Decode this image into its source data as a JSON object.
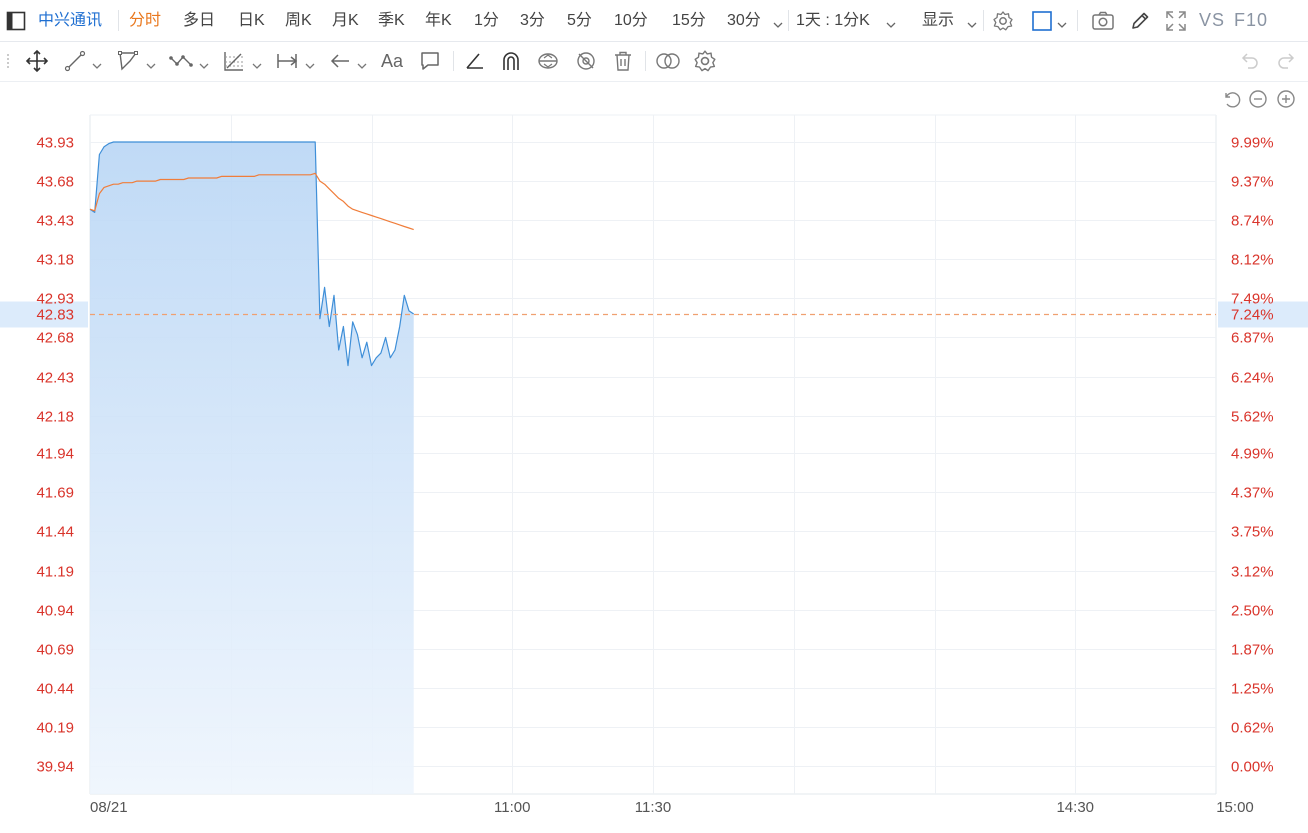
{
  "topbar": {
    "stock_name": "中兴通讯",
    "periods": [
      "分时",
      "多日",
      "日K",
      "周K",
      "月K",
      "季K",
      "年K",
      "1分",
      "3分",
      "5分",
      "10分",
      "15分",
      "30分"
    ],
    "active_period": "分时",
    "candle_mode": "1天 : 1分K",
    "display_label": "显示",
    "vs_label": "VS",
    "f10_label": "F10"
  },
  "drawing_toolbar": {
    "text_tool_label": "Aa"
  },
  "chart_data": {
    "type": "line",
    "title": "",
    "x_ticks": [
      "08/21",
      "11:00",
      "11:30",
      "14:30",
      "15:00"
    ],
    "price_ticks": [
      43.93,
      43.68,
      43.43,
      43.18,
      42.93,
      42.68,
      42.43,
      42.18,
      41.94,
      41.69,
      41.44,
      41.19,
      40.94,
      40.69,
      40.44,
      40.19,
      39.94
    ],
    "pct_ticks": [
      "9.99%",
      "9.37%",
      "8.74%",
      "8.12%",
      "7.49%",
      "6.87%",
      "6.24%",
      "5.62%",
      "4.99%",
      "4.37%",
      "3.75%",
      "3.12%",
      "2.50%",
      "1.87%",
      "1.25%",
      "0.62%",
      "0.00%"
    ],
    "ylim": [
      39.94,
      43.93
    ],
    "current_price": "42.83",
    "current_pct": "7.24%",
    "trading_minutes": 240,
    "series": [
      {
        "color": "#3f8fd8",
        "values": [
          43.5,
          43.48,
          43.85,
          43.9,
          43.92,
          43.93,
          43.93,
          43.93,
          43.93,
          43.93,
          43.93,
          43.93,
          43.93,
          43.93,
          43.93,
          43.93,
          43.93,
          43.93,
          43.93,
          43.93,
          43.93,
          43.93,
          43.93,
          43.93,
          43.93,
          43.93,
          43.93,
          43.93,
          43.93,
          43.93,
          43.93,
          43.93,
          43.93,
          43.93,
          43.93,
          43.93,
          43.93,
          43.93,
          43.93,
          43.93,
          43.93,
          43.93,
          43.93,
          43.93,
          43.93,
          43.93,
          43.93,
          43.93,
          43.93,
          42.8,
          43.0,
          42.75,
          42.95,
          42.6,
          42.75,
          42.5,
          42.78,
          42.7,
          42.55,
          42.65,
          42.5,
          42.55,
          42.58,
          42.68,
          42.55,
          42.6,
          42.75,
          42.95,
          42.85,
          42.83
        ]
      },
      {
        "color": "#f07d3a",
        "values": [
          43.5,
          43.49,
          43.6,
          43.64,
          43.65,
          43.66,
          43.66,
          43.67,
          43.67,
          43.67,
          43.68,
          43.68,
          43.68,
          43.68,
          43.68,
          43.69,
          43.69,
          43.69,
          43.69,
          43.69,
          43.69,
          43.7,
          43.7,
          43.7,
          43.7,
          43.7,
          43.7,
          43.7,
          43.71,
          43.71,
          43.71,
          43.71,
          43.71,
          43.71,
          43.71,
          43.71,
          43.72,
          43.72,
          43.72,
          43.72,
          43.72,
          43.72,
          43.72,
          43.72,
          43.72,
          43.72,
          43.72,
          43.72,
          43.73,
          43.68,
          43.66,
          43.63,
          43.6,
          43.57,
          43.55,
          43.52,
          43.5,
          43.49,
          43.48,
          43.47,
          43.46,
          43.45,
          43.44,
          43.43,
          43.42,
          43.41,
          43.4,
          43.39,
          43.38,
          43.37
        ]
      }
    ]
  },
  "colors": {
    "accent": "#1f6fd1",
    "active": "#e9781e",
    "up": "#d9342b",
    "price_line": "#3f8fd8",
    "avg_line": "#f07d3a",
    "prev_close_line": "#f0a070",
    "current_highlight": "#dcebfb"
  }
}
